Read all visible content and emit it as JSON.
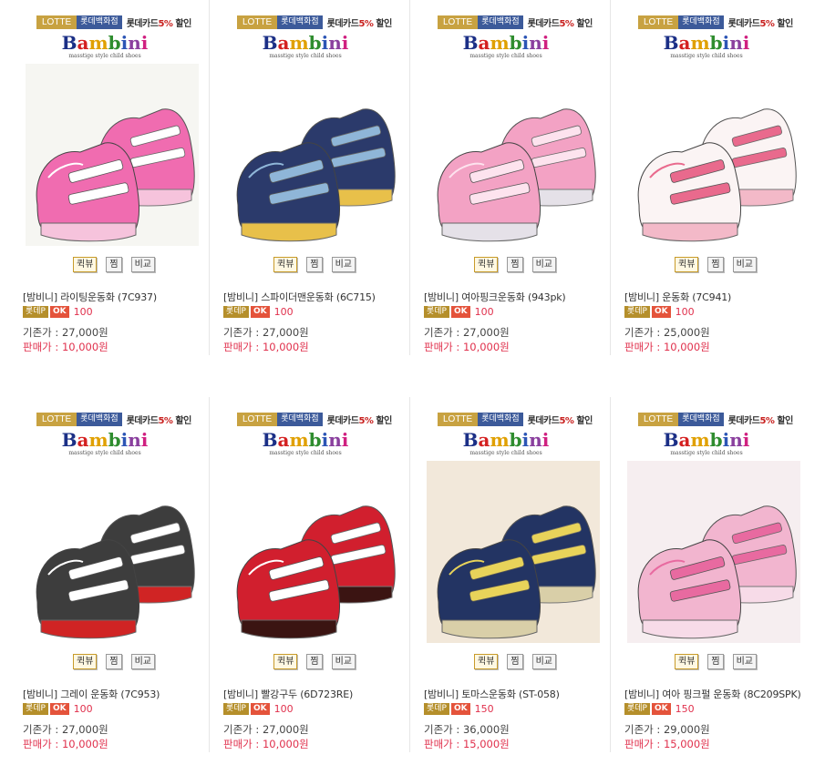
{
  "banner": {
    "lotte": "LOTTE",
    "dept": "롯데백화점",
    "card": "롯데카드",
    "pct": "5%",
    "card_tail": " 할인"
  },
  "brand": {
    "name": [
      "B",
      "a",
      "m",
      "b",
      "i",
      "n",
      "i"
    ],
    "name_colors": [
      "#1b2f86",
      "#d42020",
      "#e0a000",
      "#2f8d2f",
      "#2c55b5",
      "#8a3f9e",
      "#d02080"
    ],
    "tagline": "masstige style child shoes"
  },
  "buttons": {
    "review": "퀵뷰",
    "wish": "찜",
    "compare": "비교"
  },
  "labels": {
    "point_badge": "롯데P",
    "ok_badge": "OK",
    "old_price": "기존가 : ",
    "sale_price": "판매가 : "
  },
  "products": [
    {
      "name": "[밤비니] 라이팅운동화 (7C937)",
      "point": "100",
      "old_price": "27,000원",
      "sale_price": "10,000원",
      "shoe": "pink-sneaker",
      "color_main": "#f06cb0",
      "color_accent": "#ffffff",
      "color_sole": "#f6c3dc",
      "bg": "#f6f6f2"
    },
    {
      "name": "[밤비니] 스파이더맨운동화 (6C715)",
      "point": "100",
      "old_price": "27,000원",
      "sale_price": "10,000원",
      "shoe": "navy-sneaker",
      "color_main": "#2b3a6b",
      "color_accent": "#8fb6d8",
      "color_sole": "#e8c04a",
      "bg": "#ffffff"
    },
    {
      "name": "[밤비니] 여아핑크운동화 (943pk)",
      "point": "100",
      "old_price": "27,000원",
      "sale_price": "10,000원",
      "shoe": "pink-sneaker",
      "color_main": "#f3a2c4",
      "color_accent": "#fde3ee",
      "color_sole": "#e5e1e8",
      "bg": "#ffffff"
    },
    {
      "name": "[밤비니] 운동화 (7C941)",
      "point": "100",
      "old_price": "25,000원",
      "sale_price": "10,000원",
      "shoe": "floral-sneaker",
      "color_main": "#fbf4f4",
      "color_accent": "#e96a8d",
      "color_sole": "#f3b9c8",
      "bg": "#ffffff"
    },
    {
      "name": "[밤비니] 그레이 운동화 (7C953)",
      "point": "100",
      "old_price": "27,000원",
      "sale_price": "10,000원",
      "shoe": "gray-sneaker",
      "color_main": "#3d3d3d",
      "color_accent": "#ffffff",
      "color_sole": "#d02424",
      "bg": "#ffffff"
    },
    {
      "name": "[밤비니] 빨강구두 (6D723RE)",
      "point": "100",
      "old_price": "27,000원",
      "sale_price": "10,000원",
      "shoe": "red-maryjane",
      "color_main": "#d11f2e",
      "color_accent": "#ffffff",
      "color_sole": "#3b1412",
      "bg": "#ffffff"
    },
    {
      "name": "[밤비니] 토마스운동화 (ST-058)",
      "point": "150",
      "old_price": "36,000원",
      "sale_price": "15,000원",
      "shoe": "thomas-sneaker",
      "color_main": "#233463",
      "color_accent": "#e8d35a",
      "color_sole": "#d9cfa8",
      "bg": "#f2e8da"
    },
    {
      "name": "[밤비니] 여아 핑크펄 운동화 (8C209SPK)",
      "point": "150",
      "old_price": "29,000원",
      "sale_price": "15,000원",
      "shoe": "pearl-sneaker",
      "color_main": "#f2b5cf",
      "color_accent": "#e86aa0",
      "color_sole": "#f7dbe8",
      "bg": "#f6eef0"
    }
  ]
}
